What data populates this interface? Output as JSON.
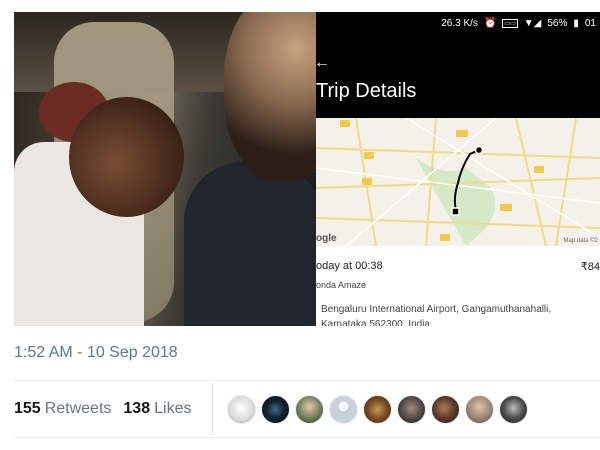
{
  "phone": {
    "status": {
      "speed": "26.3 K/s",
      "battery": "56%",
      "time": "01"
    },
    "title": "Trip Details",
    "map": {
      "credit": "Map data ©2"
    },
    "trip": {
      "when": "oday at 00:38",
      "fare": "₹84",
      "car": "onda Amaze"
    },
    "address_lines": [
      "Bengaluru International Airport, Gangamuthanahalli,",
      "Karnataka 562300, India"
    ]
  },
  "tweet": {
    "timestamp": "1:52 AM - 10 Sep 2018",
    "retweets_count": "155",
    "retweets_label": "Retweets",
    "likes_count": "138",
    "likes_label": "Likes"
  },
  "colors": {
    "muted": "#657786",
    "dark": "#14171a",
    "route": "#000000"
  }
}
